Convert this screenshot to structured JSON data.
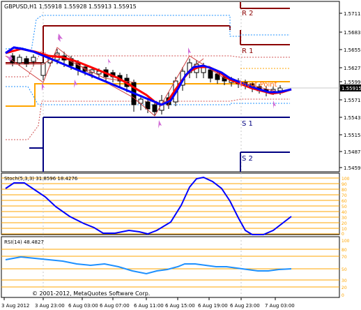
{
  "main": {
    "title": "GBPUSD,H1  1.55918 1.55928 1.55913 1.55915",
    "price_labels": [
      "1.57115",
      "1.56830",
      "1.56555",
      "1.56270",
      "1.55990",
      "1.55710",
      "1.55430",
      "1.55150",
      "1.54870",
      "1.54590"
    ],
    "current_price": "1.55915",
    "pivot_labels": {
      "r2": "R 2",
      "r1": "R 1",
      "pivot": "Pivot Point",
      "s1": "S 1",
      "s2": "S 2"
    }
  },
  "stoch": {
    "title": "Stoch(5,3,3) 31.8596 18.4276",
    "level_labels": [
      "100",
      "90",
      "80",
      "70",
      "60",
      "50",
      "40",
      "30",
      "20",
      "10",
      "0"
    ]
  },
  "rsi": {
    "title": "RSI(14) 48.4827",
    "level_labels": [
      "100",
      "80",
      "70",
      "50",
      "30",
      "20",
      "0"
    ]
  },
  "copyright": "© 2001-2012, MetaQuotes Software Corp.",
  "time_labels": [
    "3 Aug 2012",
    "3 Aug 23:00",
    "6 Aug 03:00",
    "6 Aug 07:00",
    "6 Aug 11:00",
    "6 Aug 15:00",
    "6 Aug 19:00",
    "6 Aug 23:00",
    "7 Aug 03:00"
  ],
  "colors": {
    "bg": "#ffffff",
    "grid": "#c8c8c8",
    "resistance": "#8b0000",
    "support": "#000080",
    "pivot": "#ffa500",
    "ma_red": "#ff0000",
    "ma_blue": "#0000ff",
    "arrow": "#d06ad6",
    "stoch_line": "#0000ff",
    "stoch_levels": "#ffa500",
    "rsi_line": "#1e90ff",
    "rsi_levels": "#ffa500",
    "price_box": "#000000"
  }
}
